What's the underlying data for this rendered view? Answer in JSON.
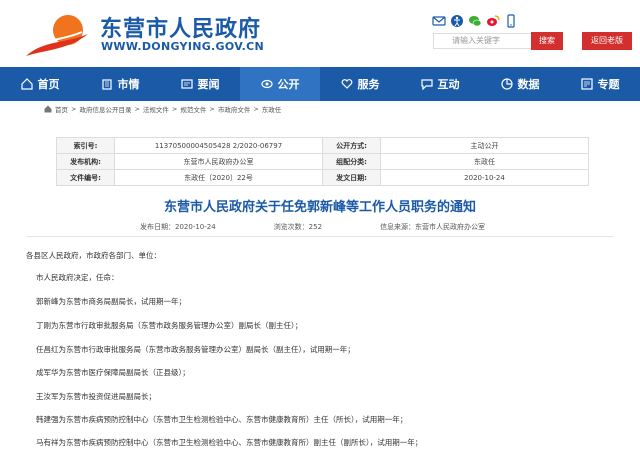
{
  "header": {
    "site_title": "东营市人民政府",
    "site_url": "WWW.DONGYING.GOV.CN",
    "search_placeholder": "请输入关键字",
    "search_label": "搜索",
    "old_version_label": "返回老版",
    "icons": [
      "mail-icon",
      "accessibility-icon",
      "wechat-icon",
      "weibo-icon",
      "mobile-icon"
    ]
  },
  "nav": {
    "items": [
      {
        "label": "首页",
        "icon": "home-icon"
      },
      {
        "label": "市情",
        "icon": "building-icon"
      },
      {
        "label": "要闻",
        "icon": "news-icon"
      },
      {
        "label": "公开",
        "icon": "eye-icon",
        "active": true
      },
      {
        "label": "服务",
        "icon": "heart-icon"
      },
      {
        "label": "互动",
        "icon": "chat-icon"
      },
      {
        "label": "数据",
        "icon": "data-icon"
      },
      {
        "label": "专题",
        "icon": "topic-icon"
      }
    ]
  },
  "breadcrumb": [
    "首页",
    "政府信息公开目录",
    "法规文件",
    "规范文件",
    "市政府文件",
    "东政任"
  ],
  "meta": {
    "index_label": "索引号:",
    "index_value": "11370500004505428 2/2020-06797",
    "disclosure_label": "公开方式:",
    "disclosure_value": "主动公开",
    "issuer_label": "发布机构:",
    "issuer_value": "东营市人民政府办公室",
    "category_label": "组配分类:",
    "category_value": "东政任",
    "docno_label": "文件编号:",
    "docno_value": "东政任〔2020〕22号",
    "date_label": "发文日期:",
    "date_value": "2020-10-24"
  },
  "article": {
    "title": "东营市人民政府关于任免郭新峰等工作人员职务的通知",
    "publish_date": "发布日期：2020-10-24",
    "views": "浏览次数：252",
    "source": "信息来源：东营市人民政府办公室",
    "paragraphs": [
      "各县区人民政府，市政府各部门、单位：",
      "市人民政府决定，任命：",
      "郭新峰为东营市商务局副局长，试用期一年；",
      "丁刚为东营市行政审批服务局（东营市政务服务管理办公室）副局长（副主任）；",
      "任昌红为东营市行政审批服务局（东营市政务服务管理办公室）副局长（副主任），试用期一年；",
      "成军华为东营市医疗保障局副局长（正县级）；",
      "王汝军为东营市投资促进局副局长；",
      "韩建强为东营市疾病预防控制中心（东营市卫生检测检验中心、东营市健康教育所）主任（所长），试用期一年；",
      "马有祥为东营市疾病预防控制中心（东营市卫生检测检验中心、东营市健康教育所）副主任（副所长），试用期一年；"
    ]
  }
}
